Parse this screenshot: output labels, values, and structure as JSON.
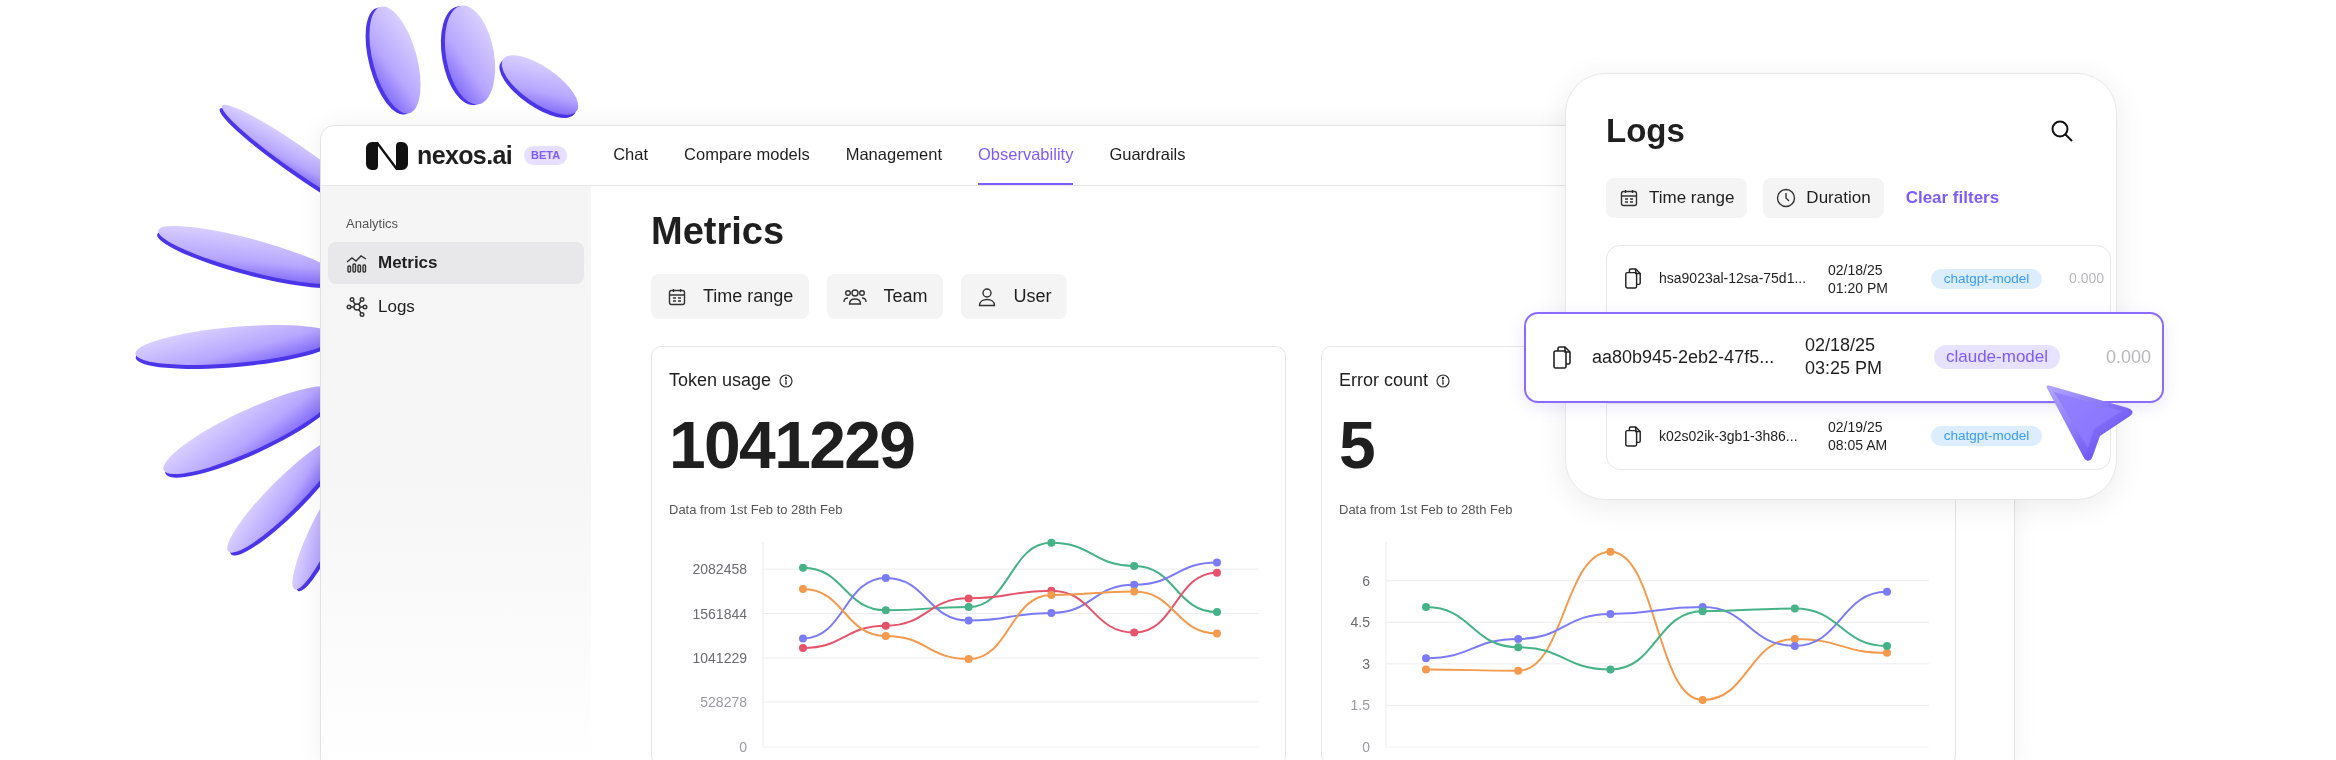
{
  "brand": {
    "name": "nexos.ai",
    "badge": "BETA"
  },
  "nav": [
    {
      "label": "Chat",
      "selected": false
    },
    {
      "label": "Compare models",
      "selected": false
    },
    {
      "label": "Management",
      "selected": false
    },
    {
      "label": "Observability",
      "selected": true
    },
    {
      "label": "Guardrails",
      "selected": false
    }
  ],
  "sidebar": {
    "heading": "Analytics",
    "items": [
      {
        "label": "Metrics",
        "selected": true
      },
      {
        "label": "Logs",
        "selected": false
      }
    ]
  },
  "page": {
    "title": "Metrics",
    "filters": [
      "Time range",
      "Team",
      "User"
    ]
  },
  "cards": [
    {
      "title": "Token usage",
      "value": "1041229",
      "caption": "Data from 1st Feb to 28th Feb",
      "chart_data": {
        "type": "line",
        "grid": true,
        "ylim": [
          0,
          2400000
        ],
        "yticks": [
          0,
          528278,
          1041229,
          1561844,
          2082458
        ],
        "series": [
          {
            "color": "#45b387",
            "marker": "circle",
            "values": [
              2100000,
              1600000,
              1640000,
              2390000,
              2120000,
              1580000
            ]
          },
          {
            "color": "#7b7bf5",
            "marker": "circle",
            "values": [
              1270000,
              1980000,
              1480000,
              1570000,
              1900000,
              2160000
            ]
          },
          {
            "color": "#e5546b",
            "marker": "circle",
            "values": [
              1160000,
              1420000,
              1740000,
              1830000,
              1340000,
              2040000
            ]
          },
          {
            "color": "#f39a4d",
            "marker": "circle",
            "values": [
              1850000,
              1300000,
              1030000,
              1780000,
              1820000,
              1330000
            ]
          }
        ]
      }
    },
    {
      "title": "Error count",
      "value": "5",
      "caption": "Data from 1st Feb to 28th Feb",
      "chart_data": {
        "type": "line",
        "grid": true,
        "ylim": [
          0,
          7.4
        ],
        "yticks": [
          0,
          1.5,
          3,
          4.5,
          6
        ],
        "series": [
          {
            "color": "#f39a4d",
            "marker": "circle",
            "values": [
              2.8,
              2.75,
              7.05,
              1.7,
              3.9,
              3.4
            ]
          },
          {
            "color": "#7b7bf5",
            "marker": "circle",
            "values": [
              3.2,
              3.9,
              4.8,
              5.05,
              3.65,
              5.6
            ]
          },
          {
            "color": "#45b387",
            "marker": "circle",
            "values": [
              5.05,
              3.6,
              2.8,
              4.9,
              5.0,
              3.65
            ]
          }
        ]
      }
    }
  ],
  "logs_panel": {
    "title": "Logs",
    "filters": [
      "Time range",
      "Duration"
    ],
    "clear_filters": "Clear filters",
    "rows": [
      {
        "id": "hsa9023al-12sa-75d1...",
        "date": "02/18/25",
        "time": "01:20 PM",
        "model": "chatgpt-model",
        "color": "#3b9cf5",
        "cost": "0.000",
        "selected": false
      },
      {
        "id": "aa80b945-2eb2-47f5...",
        "date": "02/18/25",
        "time": "03:25 PM",
        "model": "claude-model",
        "color": "#7c5cff",
        "cost": "0.000",
        "selected": true
      },
      {
        "id": "k02s02ik-3gb1-3h86...",
        "date": "02/19/25",
        "time": "08:05 AM",
        "model": "chatgpt-model",
        "color": "#3b9cf5",
        "selected": false
      }
    ]
  }
}
